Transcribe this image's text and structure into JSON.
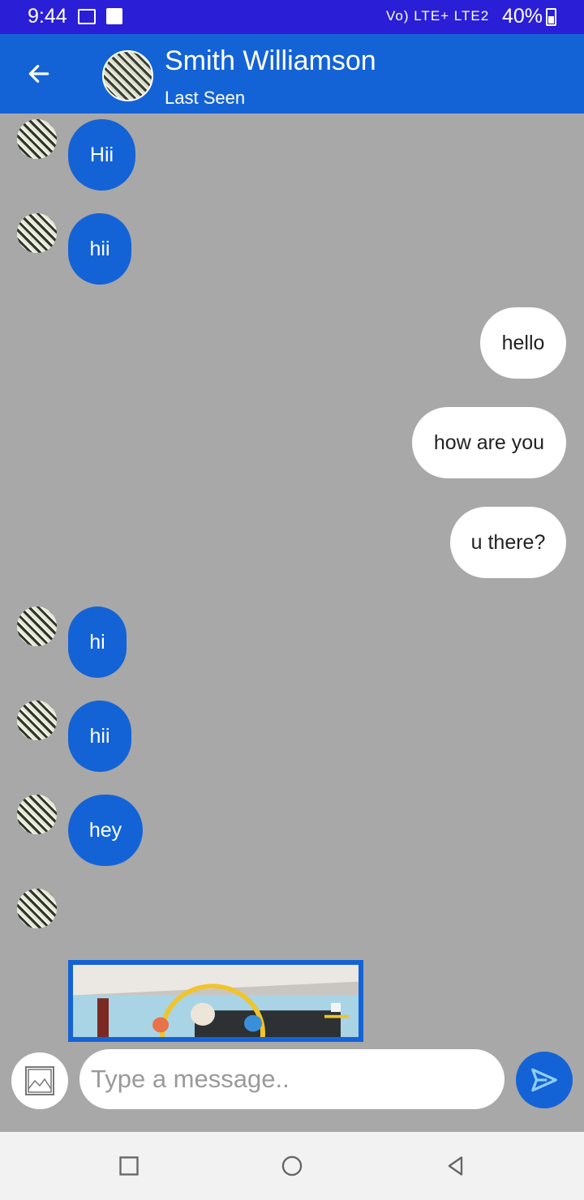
{
  "status_bar": {
    "time": "9:44",
    "network": "Vo) LTE+ LTE2",
    "battery": "40%",
    "icons": [
      "gallery-icon",
      "check-icon",
      "mute-icon",
      "signal-icon",
      "battery-icon"
    ]
  },
  "header": {
    "contact_name": "Smith Williamson",
    "status": "Last Seen",
    "back_icon": "arrow-left-icon"
  },
  "messages": [
    {
      "direction": "in",
      "text": "Hii"
    },
    {
      "direction": "in",
      "text": "hii"
    },
    {
      "direction": "out",
      "text": "hello"
    },
    {
      "direction": "out",
      "text": "how are you"
    },
    {
      "direction": "out",
      "text": "u there?"
    },
    {
      "direction": "in",
      "text": "hi"
    },
    {
      "direction": "in",
      "text": "hii"
    },
    {
      "direction": "in",
      "text": "hey"
    },
    {
      "direction": "in",
      "type": "image"
    }
  ],
  "composer": {
    "placeholder": "Type a message..",
    "value": "",
    "attach_icon": "image-icon",
    "send_icon": "send-icon"
  },
  "nav_bar": {
    "icons": [
      "recents-icon",
      "home-icon",
      "back-triangle-icon"
    ]
  },
  "colors": {
    "status_bar": "#2a1fd6",
    "app_bar": "#1463d6",
    "chat_background": "#a8a8a8",
    "incoming_bubble": "#1463d6",
    "outgoing_bubble": "#ffffff"
  }
}
